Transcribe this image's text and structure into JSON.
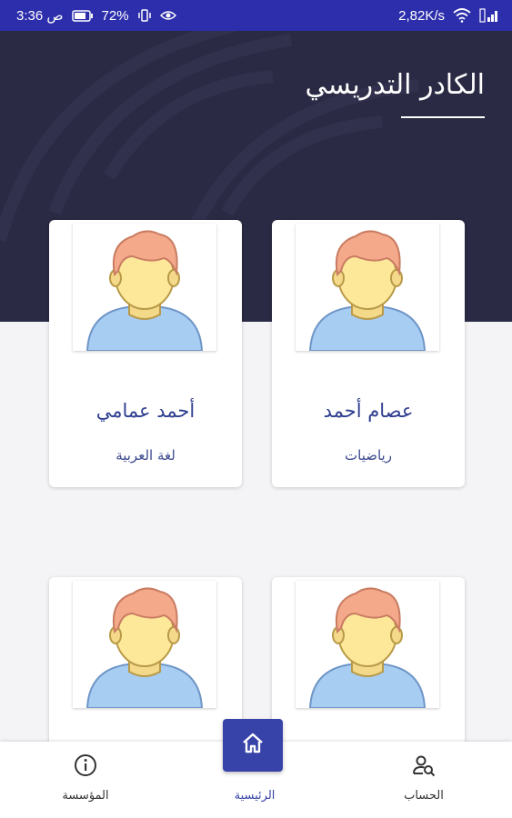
{
  "status_bar": {
    "time": "3:36 ص",
    "battery": "72%",
    "network_speed": "2,82K/s"
  },
  "header": {
    "title": "الكادر التدريسي"
  },
  "teachers": [
    {
      "name": "عصام أحمد",
      "subject": "رياضيات"
    },
    {
      "name": "أحمد عمامي",
      "subject": "لغة العربية"
    },
    {
      "name": "",
      "subject": ""
    },
    {
      "name": "",
      "subject": ""
    }
  ],
  "bottom_nav": {
    "account_label": "الحساب",
    "home_label": "الرئيسية",
    "institution_label": "المؤسسة"
  },
  "colors": {
    "status_bar": "#2c2eab",
    "header_bg": "#2a2a44",
    "accent": "#3743a8",
    "name_text": "#2f3e8f"
  },
  "icons": {
    "account": "person-search-icon",
    "home": "home-icon",
    "institution": "info-icon"
  }
}
